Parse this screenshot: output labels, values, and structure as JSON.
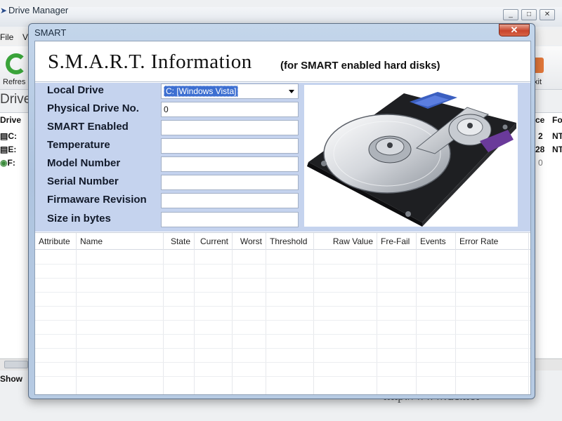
{
  "background_window": {
    "title": "Drive Manager",
    "window_buttons": [
      "_",
      "□",
      "✕"
    ],
    "menu": [
      "File",
      "V"
    ],
    "toolbar": {
      "refresh_label": "Refres",
      "exit_label": "xit"
    },
    "drives_heading": "Drive",
    "list_headers": {
      "drive": "Drive",
      "col_a": "ce",
      "col_b": "Fo"
    },
    "rows": [
      {
        "drive": "C:",
        "cell_a": "2",
        "cell_b": "NT"
      },
      {
        "drive": "E:",
        "cell_a": "28",
        "cell_b": "NT"
      },
      {
        "drive": "F:",
        "cell_a": "0",
        "cell_b": ""
      }
    ],
    "show_label": "Show",
    "watermark_url": "http://www.dc.net"
  },
  "dialog": {
    "title": "SMART",
    "close_symbol": "✕",
    "header_title": "S.M.A.R.T. Information",
    "header_subtitle": "(for SMART enabled hard disks)",
    "fields": [
      {
        "label": "Local Drive",
        "value": "C: [Windows Vista]"
      },
      {
        "label": "Physical Drive No.",
        "value": "0"
      },
      {
        "label": "SMART Enabled",
        "value": ""
      },
      {
        "label": "Temperature",
        "value": ""
      },
      {
        "label": "Model Number",
        "value": ""
      },
      {
        "label": "Serial Number",
        "value": ""
      },
      {
        "label": "Firmaware Revision",
        "value": ""
      },
      {
        "label": "Size in bytes",
        "value": ""
      }
    ],
    "image_icon": "hard-disk-image",
    "grid_headers": [
      "Attribute",
      "Name",
      "State",
      "Current",
      "Worst",
      "Threshold",
      "Raw Value",
      "Fre-Fail",
      "Events",
      "Error Rate"
    ],
    "grid_rows": []
  }
}
